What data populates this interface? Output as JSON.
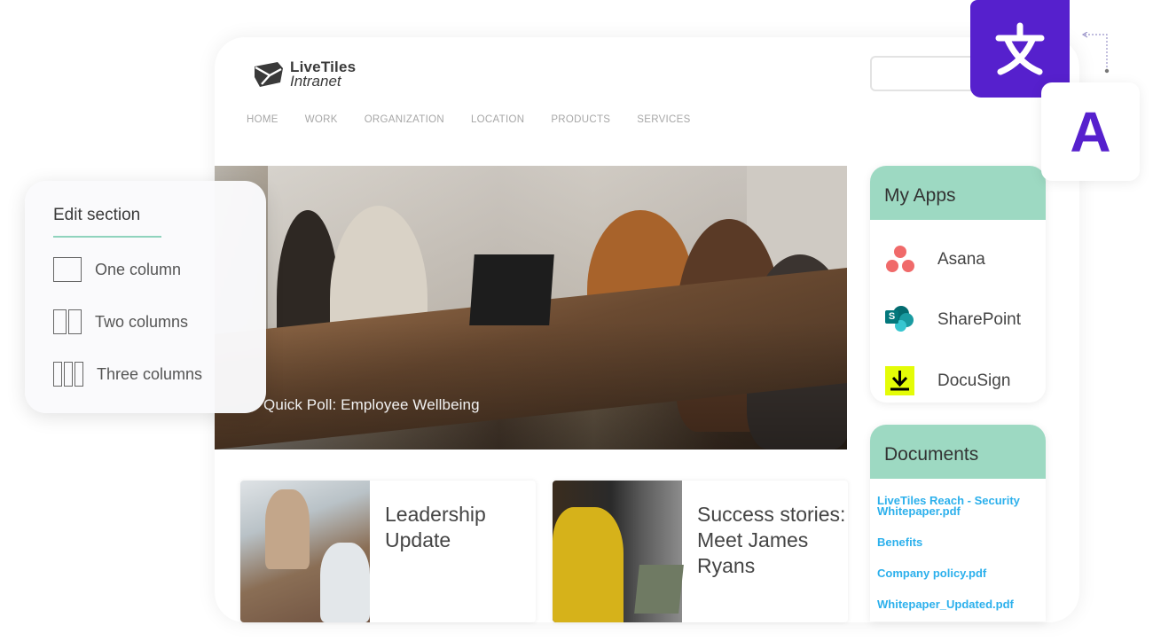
{
  "brand": {
    "logo_line1": "LiveTiles",
    "logo_line2": "Intranet",
    "icon": "livetiles-logo-icon"
  },
  "nav": {
    "items": [
      {
        "label": "HOME"
      },
      {
        "label": "WORK"
      },
      {
        "label": "ORGANIZATION"
      },
      {
        "label": "LOCATION"
      },
      {
        "label": "PRODUCTS"
      },
      {
        "label": "SERVICES"
      }
    ]
  },
  "search": {
    "value": "",
    "placeholder": ""
  },
  "hero": {
    "caption": "Quick Poll: Employee Wellbeing"
  },
  "edit_section": {
    "title": "Edit section",
    "options": [
      {
        "label": "One column",
        "icon": "one-column-icon"
      },
      {
        "label": "Two columns",
        "icon": "two-columns-icon"
      },
      {
        "label": "Three columns",
        "icon": "three-columns-icon"
      }
    ]
  },
  "articles": [
    {
      "title": "Leadership Update"
    },
    {
      "title": "Success stories: Meet James Ryans"
    }
  ],
  "my_apps": {
    "title": "My Apps",
    "items": [
      {
        "label": "Asana",
        "icon": "asana-icon"
      },
      {
        "label": "SharePoint",
        "icon": "sharepoint-icon"
      },
      {
        "label": "DocuSign",
        "icon": "docusign-icon"
      }
    ]
  },
  "documents": {
    "title": "Documents",
    "items": [
      {
        "label": "LiveTiles Reach - Security Whitepaper.pdf"
      },
      {
        "label": "Benefits"
      },
      {
        "label": "Company policy.pdf"
      },
      {
        "label": "Whitepaper_Updated.pdf"
      }
    ]
  },
  "translate": {
    "source_glyph": "文",
    "target_glyph": "A"
  },
  "colors": {
    "accent_purple": "#5620cd",
    "widget_header_mint": "#9dd9c2",
    "link_blue": "#2cb0ec",
    "nav_gray": "#a7a7a7"
  }
}
